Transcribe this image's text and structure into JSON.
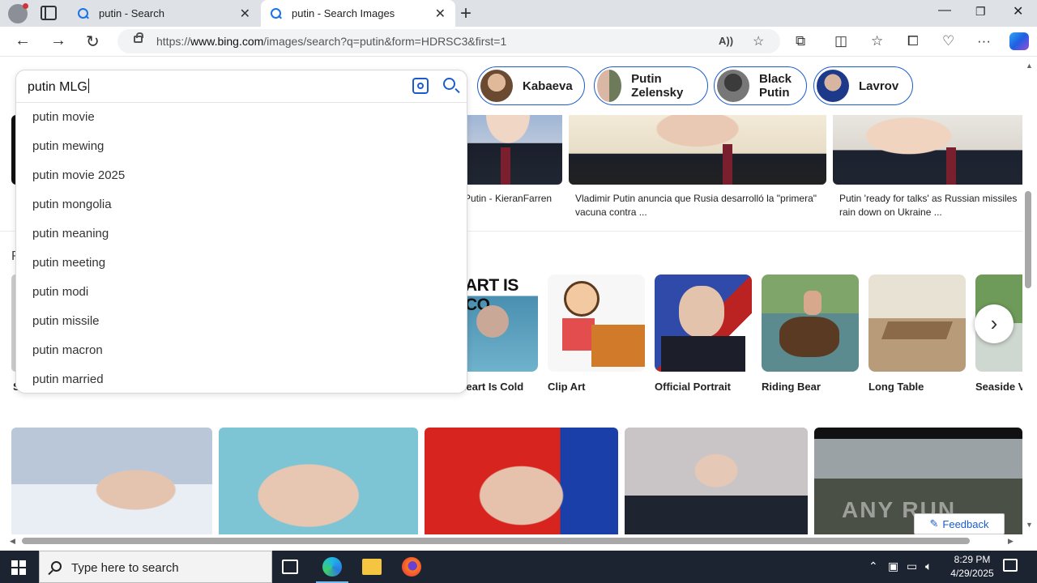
{
  "browser": {
    "tabs": [
      {
        "label": "putin - Search"
      },
      {
        "label": "putin - Search Images"
      }
    ],
    "new_tab_label": "+",
    "url_prefix": "https://",
    "url_domain": "www.bing.com",
    "url_path": "/images/search?q=putin&form=HDRSC3&first=1"
  },
  "search": {
    "query": "putin MLG",
    "suggestions": [
      "putin movie",
      "putin mewing",
      "putin movie 2025",
      "putin mongolia",
      "putin meaning",
      "putin meeting",
      "putin modi",
      "putin missile",
      "putin macron",
      "putin married"
    ]
  },
  "query_chips": [
    {
      "label": "Kabaeva"
    },
    {
      "label": "Putin Zelensky"
    },
    {
      "label": "Black Putin"
    },
    {
      "label": "Lavrov"
    }
  ],
  "results_top": [
    {
      "caption": "Putin - KieranFarren"
    },
    {
      "caption": "Vladimir Putin anuncia que Rusia desarrolló la \"primera\" vacuna contra ..."
    },
    {
      "caption": "Putin 'ready for talks' as Russian missiles rain down on Ukraine ..."
    }
  ],
  "related_heading_partial": "R",
  "related": [
    {
      "label": "Si"
    },
    {
      "label": "Heart Is Cold"
    },
    {
      "label": "Clip Art"
    },
    {
      "label": "Official Portrait"
    },
    {
      "label": "Riding Bear"
    },
    {
      "label": "Long Table"
    },
    {
      "label": "Seaside V"
    }
  ],
  "heart_is_cold_overlay": "ART IS CO",
  "feedback_label": "Feedback",
  "watermark": "ANY RUN",
  "taskbar": {
    "search_placeholder": "Type here to search",
    "time": "8:29 PM",
    "date": "4/29/2025"
  },
  "colors": {
    "accent": "#1a5ccc",
    "taskbar": "#1c2331",
    "tabstrip": "#dee1e6"
  }
}
